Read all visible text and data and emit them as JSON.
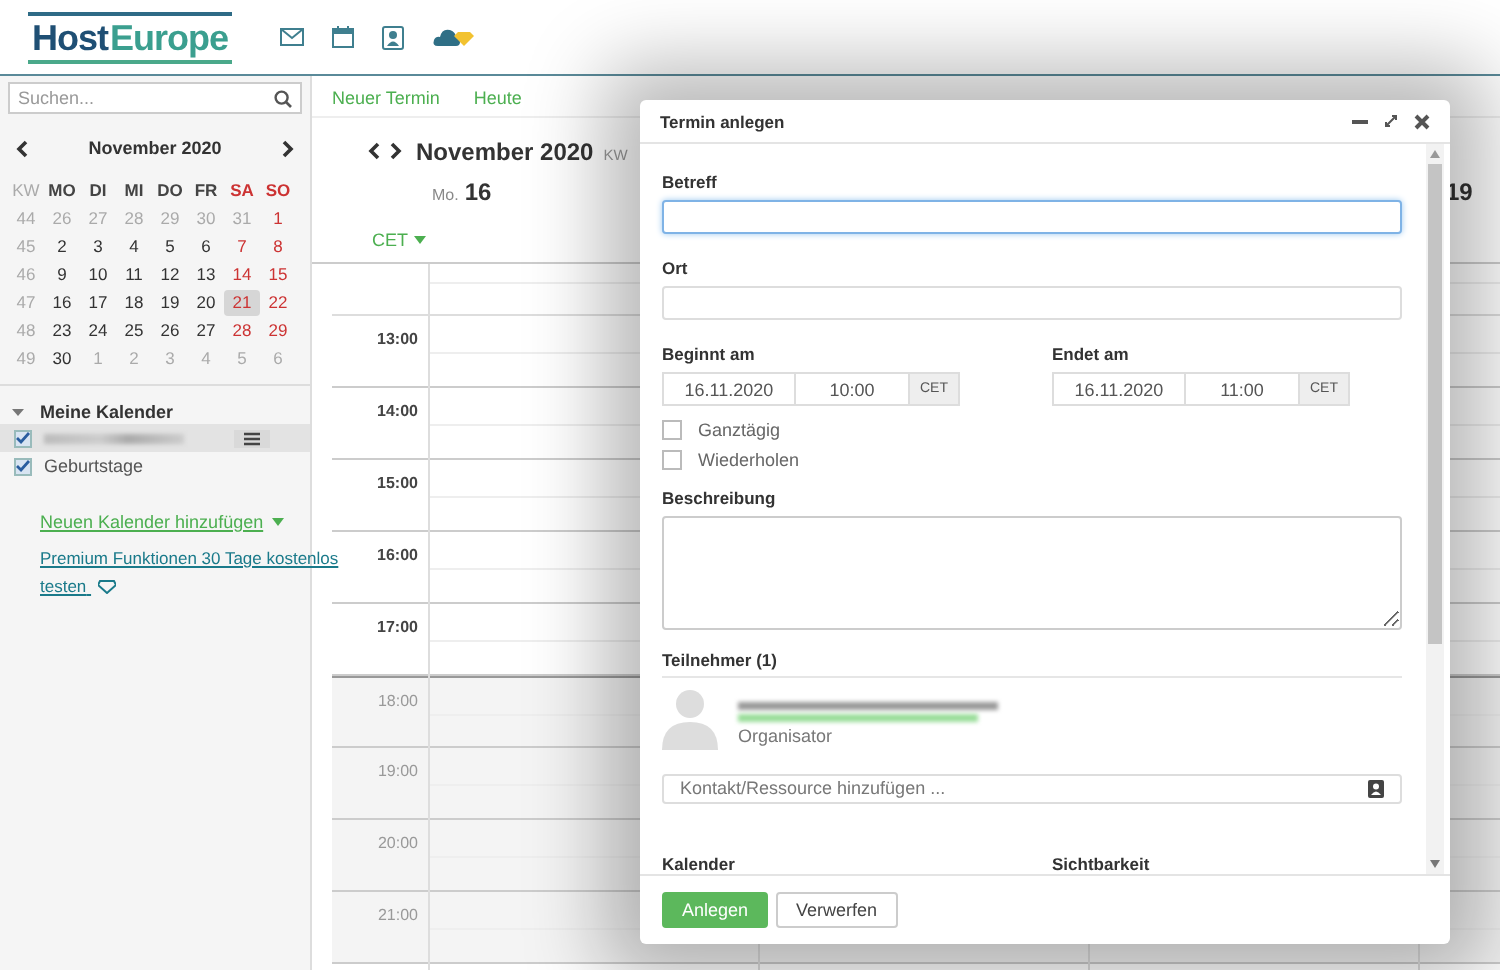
{
  "header": {
    "logo": [
      "Host",
      "Europe"
    ]
  },
  "sidebar": {
    "search": {
      "placeholder": "Suchen..."
    },
    "mini_calendar": {
      "title": "November 2020",
      "weekdays": [
        "KW",
        "MO",
        "DI",
        "MI",
        "DO",
        "FR",
        "SA",
        "SO"
      ],
      "weeks": [
        {
          "week": "44",
          "days": [
            {
              "label": "26",
              "outside": true,
              "selected": false
            },
            {
              "label": "27",
              "outside": true,
              "selected": false
            },
            {
              "label": "28",
              "outside": true,
              "selected": false
            },
            {
              "label": "29",
              "outside": true,
              "selected": false
            },
            {
              "label": "30",
              "outside": true,
              "selected": false
            },
            {
              "label": "31",
              "outside": true,
              "selected": false
            },
            {
              "label": "1",
              "outside": false,
              "selected": false
            }
          ]
        },
        {
          "week": "45",
          "days": [
            {
              "label": "2",
              "outside": false,
              "selected": false
            },
            {
              "label": "3",
              "outside": false,
              "selected": false
            },
            {
              "label": "4",
              "outside": false,
              "selected": false
            },
            {
              "label": "5",
              "outside": false,
              "selected": false
            },
            {
              "label": "6",
              "outside": false,
              "selected": false
            },
            {
              "label": "7",
              "outside": false,
              "selected": false
            },
            {
              "label": "8",
              "outside": false,
              "selected": false
            }
          ]
        },
        {
          "week": "46",
          "days": [
            {
              "label": "9",
              "outside": false,
              "selected": false
            },
            {
              "label": "10",
              "outside": false,
              "selected": false
            },
            {
              "label": "11",
              "outside": false,
              "selected": false
            },
            {
              "label": "12",
              "outside": false,
              "selected": false
            },
            {
              "label": "13",
              "outside": false,
              "selected": false
            },
            {
              "label": "14",
              "outside": false,
              "selected": false
            },
            {
              "label": "15",
              "outside": false,
              "selected": false
            }
          ]
        },
        {
          "week": "47",
          "days": [
            {
              "label": "16",
              "outside": false,
              "selected": false
            },
            {
              "label": "17",
              "outside": false,
              "selected": false
            },
            {
              "label": "18",
              "outside": false,
              "selected": false
            },
            {
              "label": "19",
              "outside": false,
              "selected": false
            },
            {
              "label": "20",
              "outside": false,
              "selected": false
            },
            {
              "label": "21",
              "outside": false,
              "selected": true
            },
            {
              "label": "22",
              "outside": false,
              "selected": false
            }
          ]
        },
        {
          "week": "48",
          "days": [
            {
              "label": "23",
              "outside": false,
              "selected": false
            },
            {
              "label": "24",
              "outside": false,
              "selected": false
            },
            {
              "label": "25",
              "outside": false,
              "selected": false
            },
            {
              "label": "26",
              "outside": false,
              "selected": false
            },
            {
              "label": "27",
              "outside": false,
              "selected": false
            },
            {
              "label": "28",
              "outside": false,
              "selected": false
            },
            {
              "label": "29",
              "outside": false,
              "selected": false
            }
          ]
        },
        {
          "week": "49",
          "days": [
            {
              "label": "30",
              "outside": false,
              "selected": false
            },
            {
              "label": "1",
              "outside": true,
              "selected": false
            },
            {
              "label": "2",
              "outside": true,
              "selected": false
            },
            {
              "label": "3",
              "outside": true,
              "selected": false
            },
            {
              "label": "4",
              "outside": true,
              "selected": false
            },
            {
              "label": "5",
              "outside": true,
              "selected": false
            },
            {
              "label": "6",
              "outside": true,
              "selected": false
            }
          ]
        }
      ]
    },
    "calendars": {
      "title": "Meine Kalender",
      "expanded": true,
      "items": [
        {
          "kind": "blurred",
          "checked": true,
          "selected": true
        },
        {
          "kind": "named",
          "label": "Geburtstage",
          "checked": true,
          "selected": false
        }
      ]
    },
    "links": [
      {
        "kind": "dropdown",
        "label": "Neuen Kalender hinzufügen"
      },
      {
        "kind": "premium",
        "label": "Premium Funktionen 30 Tage kostenlos testen"
      }
    ]
  },
  "main": {
    "toolbar": [
      "Neuer Termin",
      "Heute"
    ],
    "title": "November 2020",
    "week": "KW",
    "timezone": "CET",
    "days": [
      {
        "weekday": "Mo.",
        "day": "16"
      },
      {
        "day": "19"
      }
    ],
    "hours": [
      {
        "label": "13:00",
        "off_hours": false
      },
      {
        "label": "14:00",
        "off_hours": false
      },
      {
        "label": "15:00",
        "off_hours": false
      },
      {
        "label": "16:00",
        "off_hours": false
      },
      {
        "label": "17:00",
        "off_hours": false
      },
      {
        "label": "18:00",
        "off_hours": true
      },
      {
        "label": "19:00",
        "off_hours": true
      },
      {
        "label": "20:00",
        "off_hours": true
      },
      {
        "label": "21:00",
        "off_hours": true
      }
    ]
  },
  "dialog": {
    "title": "Termin anlegen",
    "subject": {
      "label": "Betreff",
      "focused": true
    },
    "location": {
      "label": "Ort",
      "focused": false
    },
    "start": {
      "label": "Beginnt am",
      "date": "16.11.2020",
      "time": "10:00",
      "timezone": "CET"
    },
    "end": {
      "label": "Endet am",
      "date": "16.11.2020",
      "time": "11:00",
      "timezone": "CET"
    },
    "options": [
      {
        "label": "Ganztägig",
        "checked": false
      },
      {
        "label": "Wiederholen",
        "checked": false
      }
    ],
    "description": {
      "label": "Beschreibung"
    },
    "attendees": {
      "title": "Teilnehmer (1)",
      "items": [
        {
          "role": "Organisator"
        }
      ],
      "add": {
        "placeholder": "Kontakt/Ressource hinzufügen ..."
      }
    },
    "calendar_label": "Kalender",
    "visibility_label": "Sichtbarkeit",
    "buttons": [
      {
        "kind": "primary",
        "label": "Anlegen"
      },
      {
        "kind": "secondary",
        "label": "Verwerfen"
      }
    ]
  }
}
